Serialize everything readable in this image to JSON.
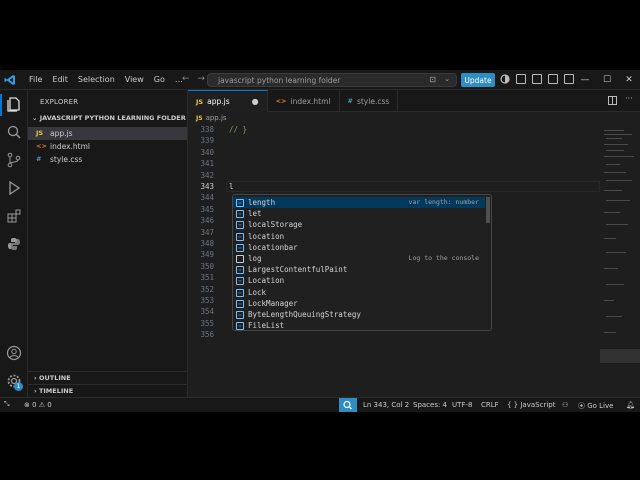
{
  "titlebar": {
    "menu": [
      "File",
      "Edit",
      "Selection",
      "View",
      "Go",
      "…"
    ],
    "command_center": "javascript python learning folder",
    "update_label": "Update",
    "window_controls": [
      "—",
      "☐",
      "✕"
    ]
  },
  "sidebar": {
    "title": "EXPLORER",
    "folder": "JAVASCRIPT PYTHON LEARNING FOLDER",
    "files": [
      {
        "icon": "JS",
        "name": "app.js",
        "color": "#e8c547"
      },
      {
        "icon": "<>",
        "name": "index.html",
        "color": "#e37933"
      },
      {
        "icon": "#",
        "name": "style.css",
        "color": "#519aba"
      }
    ],
    "sections": [
      "OUTLINE",
      "TIMELINE"
    ],
    "settings_badge": "1"
  },
  "tabs": [
    {
      "icon": "JS",
      "label": "app.js",
      "color": "#e8c547",
      "dirty": "●"
    },
    {
      "icon": "<>",
      "label": "index.html",
      "color": "#e37933"
    },
    {
      "icon": "#",
      "label": "style.css",
      "color": "#519aba"
    }
  ],
  "breadcrumb": {
    "icon": "JS",
    "file": "app.js"
  },
  "editor": {
    "lines": [
      {
        "n": "338",
        "text": "// }"
      },
      {
        "n": "339",
        "text": ""
      },
      {
        "n": "340",
        "text": ""
      },
      {
        "n": "341",
        "text": ""
      },
      {
        "n": "342",
        "text": ""
      },
      {
        "n": "343",
        "text": "l"
      },
      {
        "n": "344",
        "text": ""
      },
      {
        "n": "345",
        "text": ""
      },
      {
        "n": "346",
        "text": ""
      },
      {
        "n": "347",
        "text": ""
      },
      {
        "n": "348",
        "text": ""
      },
      {
        "n": "349",
        "text": ""
      },
      {
        "n": "350",
        "text": ""
      },
      {
        "n": "351",
        "text": ""
      },
      {
        "n": "352",
        "text": ""
      },
      {
        "n": "353",
        "text": ""
      },
      {
        "n": "354",
        "text": ""
      },
      {
        "n": "355",
        "text": ""
      },
      {
        "n": "356",
        "text": ""
      }
    ]
  },
  "suggestions": [
    {
      "label": "length",
      "detail": "var length: number",
      "kind": "field"
    },
    {
      "label": "let",
      "detail": "",
      "kind": "field"
    },
    {
      "label": "localStorage",
      "detail": "",
      "kind": "field"
    },
    {
      "label": "location",
      "detail": "",
      "kind": "field"
    },
    {
      "label": "locationbar",
      "detail": "",
      "kind": "field"
    },
    {
      "label": "log",
      "detail": "Log to the console",
      "kind": "snippet"
    },
    {
      "label": "LargestContentfulPaint",
      "detail": "",
      "kind": "field"
    },
    {
      "label": "Location",
      "detail": "",
      "kind": "field"
    },
    {
      "label": "Lock",
      "detail": "",
      "kind": "field"
    },
    {
      "label": "LockManager",
      "detail": "",
      "kind": "field"
    },
    {
      "label": "ByteLengthQueuingStrategy",
      "detail": "",
      "kind": "field"
    },
    {
      "label": "FileList",
      "detail": "",
      "kind": "field"
    }
  ],
  "statusbar": {
    "problems": "⊗ 0 ⚠ 0",
    "position": "Ln 343, Col 2",
    "spaces": "Spaces: 4",
    "encoding": "UTF-8",
    "eol": "CRLF",
    "language": "{ } JavaScript",
    "golive": "⦿ Go Live"
  }
}
